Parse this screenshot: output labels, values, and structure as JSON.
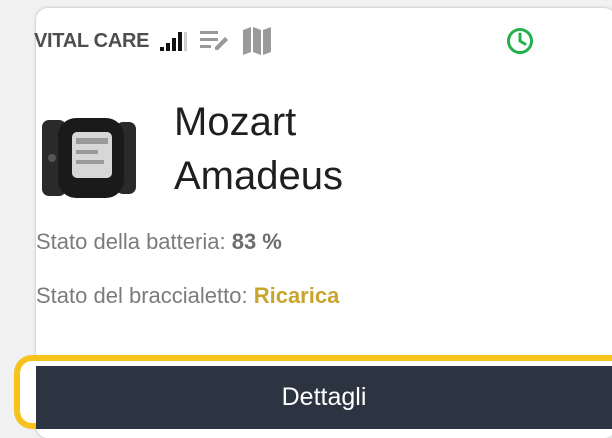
{
  "card": {
    "brand": "VITAL CARE",
    "signal_icon": "signal-bars-icon",
    "notes_icon": "edit-notes-icon",
    "map_icon": "map-icon",
    "status_icon": "clock-icon",
    "status_color": "#22b14c"
  },
  "device": {
    "image_icon": "smartwatch-icon",
    "name_line1": "Mozart",
    "name_line2": "Amadeus"
  },
  "battery": {
    "label": "Stato della batteria:",
    "value": "83 %"
  },
  "bracelet": {
    "label": "Stato del braccialetto:",
    "value": "Ricarica",
    "value_color": "#c8a52f"
  },
  "actions": {
    "details_label": "Dettagli",
    "highlight_color": "#f5c31c"
  }
}
